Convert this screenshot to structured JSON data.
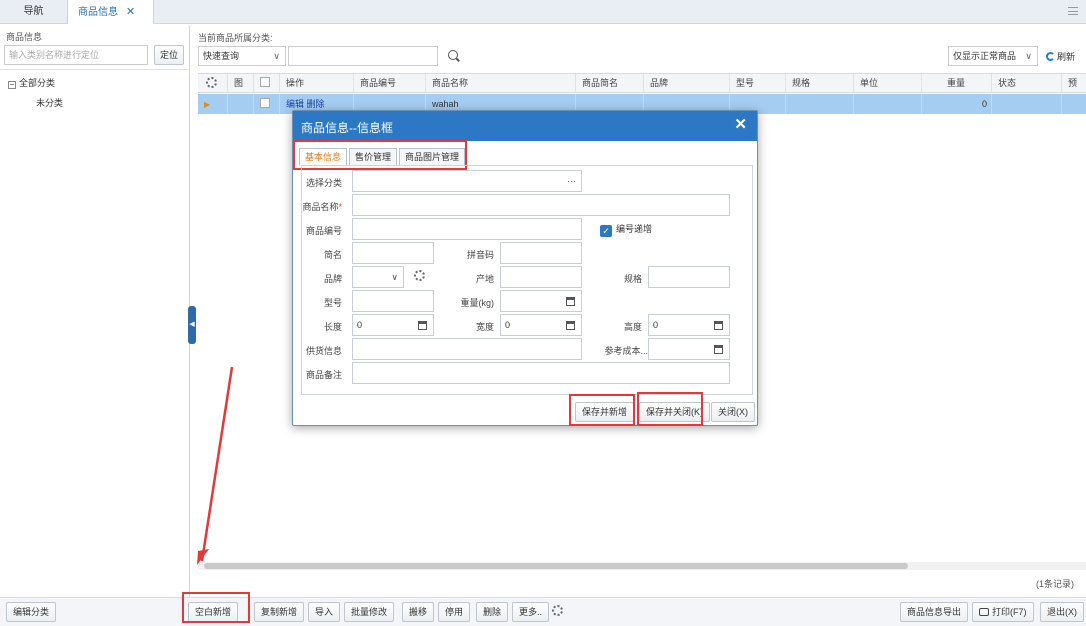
{
  "tabs": {
    "nav": "导航",
    "active": "商品信息",
    "close": "✕"
  },
  "left_panel": {
    "title": "商品信息",
    "search_placeholder": "输入类别名称进行定位",
    "locate_button": "定位",
    "tree_root": "全部分类",
    "tree_child": "未分类",
    "collapse_glyph": "◀"
  },
  "toolbar": {
    "current_category_label": "当前商品所属分类:",
    "quick_query": "快速查询",
    "filter": "仅显示正常商品",
    "refresh": "刷新"
  },
  "grid": {
    "columns": [
      "图",
      "操作",
      "商品编号",
      "商品名称",
      "商品简名",
      "品牌",
      "型号",
      "规格",
      "单位",
      "重量",
      "状态",
      "预"
    ],
    "row": {
      "actions": "编辑 删除",
      "name": "wahah",
      "weight": "0"
    },
    "record_count": "(1条记录)"
  },
  "bottom_bar": {
    "edit_category": "编辑分类",
    "buttons": [
      "空白新增",
      "复制新增",
      "导入",
      "批量修改",
      "搬移",
      "停用",
      "删除",
      "更多.."
    ],
    "export": "商品信息导出",
    "print": "打印(F7)",
    "exit": "退出(X)"
  },
  "dialog": {
    "title": "商品信息--信息框",
    "close": "✕",
    "tabs": [
      "基本信息",
      "售价管理",
      "商品图片管理"
    ],
    "labels": {
      "category": "选择分类",
      "name": "商品名称",
      "code": "商品编号",
      "auto_inc": "编号递增",
      "short_name": "简名",
      "pinyin": "拼音码",
      "brand": "品牌",
      "origin": "产地",
      "spec": "规格",
      "model": "型号",
      "weight": "重量(kg)",
      "length": "长度",
      "width": "宽度",
      "height": "高度",
      "supplier": "供货信息",
      "ref_cost": "参考成本...",
      "remark": "商品备注"
    },
    "values": {
      "length": "0",
      "width": "0",
      "height": "0",
      "category_dots": "···"
    },
    "buttons": {
      "save_new": "保存并新增",
      "save_close": "保存并关闭(K)",
      "close": "关闭(X)"
    }
  },
  "colors": {
    "accent": "#2d78c4",
    "annotation": "#e23a3a",
    "row_selected": "#a5cdf1"
  }
}
